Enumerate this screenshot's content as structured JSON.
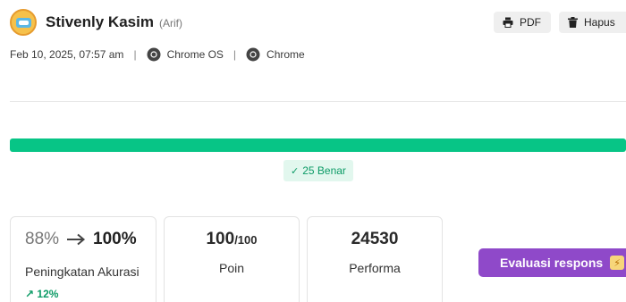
{
  "student": {
    "name": "Stivenly Kasim",
    "alias": "(Arif)"
  },
  "actions": {
    "pdf_label": "PDF",
    "delete_label": "Hapus"
  },
  "meta": {
    "datetime": "Feb 10, 2025, 07:57 am",
    "os": "Chrome OS",
    "browser": "Chrome"
  },
  "progress": {
    "correct_fraction": 1.0,
    "badge_label": "25 Benar"
  },
  "stats": {
    "accuracy": {
      "from": "88%",
      "to": "100%",
      "label": "Peningkatan Akurasi",
      "gain": "12%"
    },
    "points": {
      "value": "100",
      "total": "/100",
      "label": "Poin"
    },
    "performance": {
      "value": "24530",
      "label": "Performa"
    }
  },
  "evaluate_button": {
    "label": "Evaluasi respons"
  },
  "colors": {
    "accent_green": "#07c586",
    "purple": "#8f49c9"
  }
}
